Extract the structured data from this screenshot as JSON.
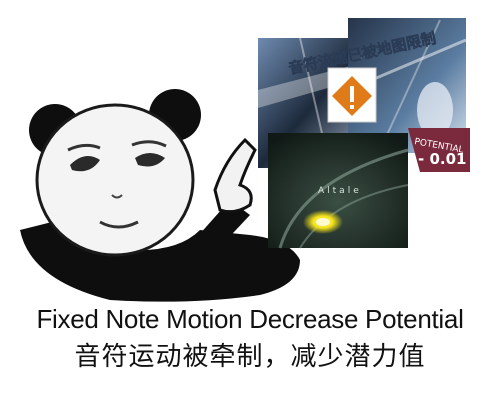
{
  "caption": {
    "english": "Fixed Note Motion Decrease Potential",
    "chinese": "音符运动被牵制，减少潜力值"
  },
  "collage": {
    "banner_text": "音符流速已被地图限制",
    "song_title": "Altale",
    "potential_label": "POTENTIAL",
    "potential_value": "- 0.01"
  },
  "colors": {
    "background": "#ffffff",
    "text": "#111111",
    "warning_orange": "#e07b1a",
    "potential_badge": "#7a2a3c",
    "note_yellow": "#f4e21a"
  }
}
